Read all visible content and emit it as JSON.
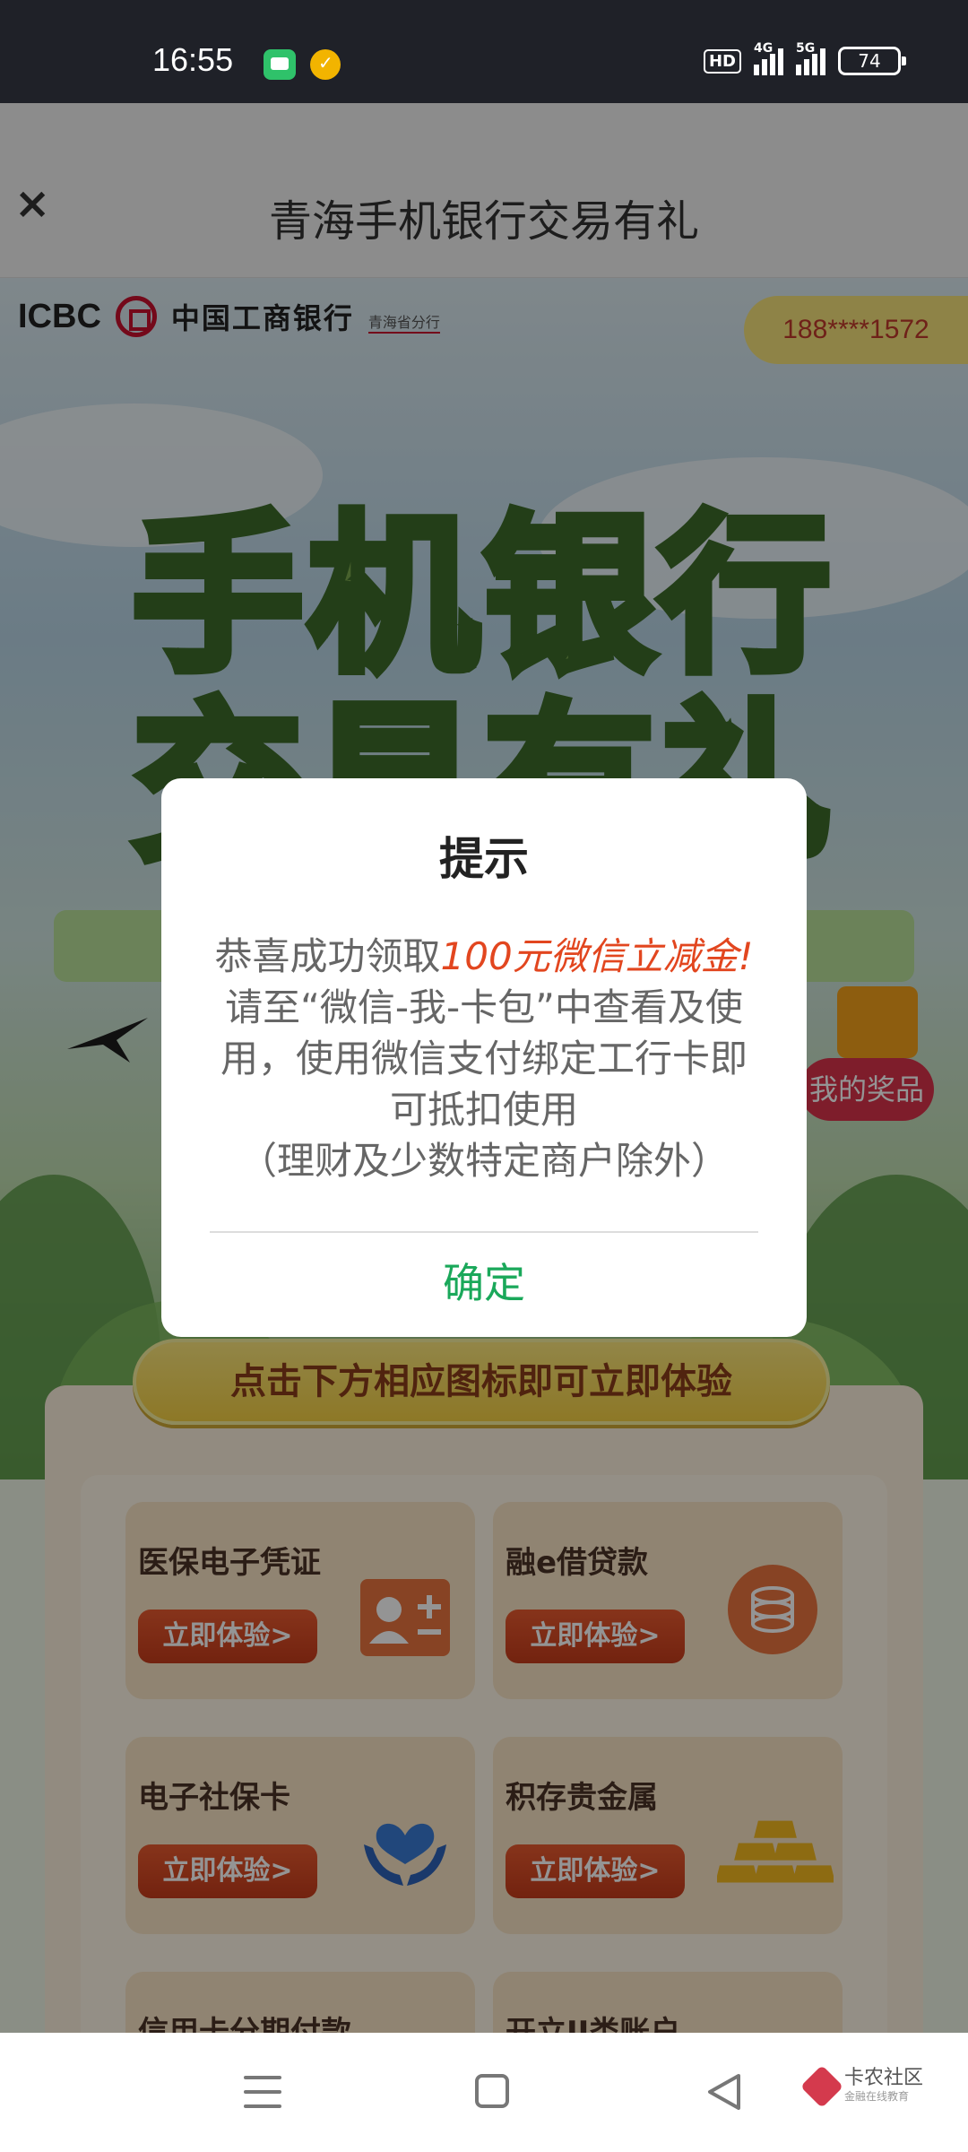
{
  "status_bar": {
    "time": "16:55",
    "hd_badge": "HD",
    "signal_1_label": "4G",
    "signal_2_label": "5G",
    "battery": "74"
  },
  "header": {
    "title": "青海手机银行交易有礼",
    "close_icon": "×"
  },
  "hero": {
    "bank_en": "ICBC",
    "bank_cn": "中国工商银行",
    "branch": "青海省分行",
    "phone": "188****1572",
    "headline_1": "手机银行",
    "headline_2": "交易有礼",
    "prize_label": "我的奖品"
  },
  "cta": {
    "label": "点击下方相应图标即可立即体验"
  },
  "cards": [
    {
      "title": "医保电子凭证",
      "button": "立即体验>",
      "icon": "id-card-icon"
    },
    {
      "title": "融e借贷款",
      "button": "立即体验>",
      "icon": "coins-icon"
    },
    {
      "title": "电子社保卡",
      "button": "立即体验>",
      "icon": "heart-hands-icon"
    },
    {
      "title": "积存贵金属",
      "button": "立即体验>",
      "icon": "gold-bars-icon"
    },
    {
      "title": "信用卡分期付款",
      "button": "",
      "icon": ""
    },
    {
      "title": "开立II类账户",
      "button": "",
      "icon": ""
    }
  ],
  "dialog": {
    "title": "提示",
    "line_prefix": "恭喜成功领取",
    "highlight": "100元微信立减金!",
    "body_2": "请至“微信-我-卡包”中查看及使用，使用微信支付绑定工行卡即可抵扣使用",
    "body_3": "（理财及少数特定商户除外）",
    "ok_label": "确定"
  },
  "navbar": {
    "watermark": "卡农社区",
    "watermark_sub": "金融在线教育"
  },
  "colors": {
    "accent_green": "#1aa85a",
    "highlight_red": "#e2461f",
    "button_orange": "#d8482a"
  }
}
